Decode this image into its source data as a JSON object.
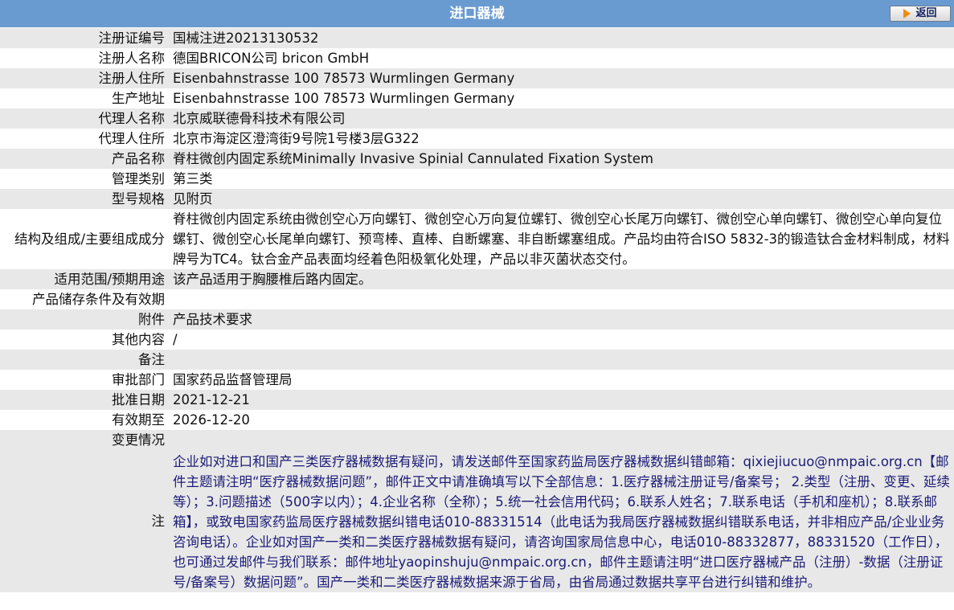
{
  "header": {
    "title": "进口器械",
    "back_label": "返回"
  },
  "rows": [
    {
      "label": "注册证编号",
      "value": "国械注进20213130532"
    },
    {
      "label": "注册人名称",
      "value": "德国BRICON公司 bricon GmbH"
    },
    {
      "label": "注册人住所",
      "value": "Eisenbahnstrasse 100 78573 Wurmlingen Germany"
    },
    {
      "label": "生产地址",
      "value": "Eisenbahnstrasse 100 78573 Wurmlingen Germany"
    },
    {
      "label": "代理人名称",
      "value": "北京威联德骨科技术有限公司"
    },
    {
      "label": "代理人住所",
      "value": "北京市海淀区澄湾街9号院1号楼3层G322"
    },
    {
      "label": "产品名称",
      "value": "脊柱微创内固定系统Minimally Invasive Spinial Cannulated Fixation System"
    },
    {
      "label": "管理类别",
      "value": "第三类"
    },
    {
      "label": "型号规格",
      "value": "见附页"
    },
    {
      "label": "结构及组成/主要组成成分",
      "value": "脊柱微创内固定系统由微创空心万向螺钉、微创空心万向复位螺钉、微创空心长尾万向螺钉、微创空心单向螺钉、微创空心单向复位螺钉、微创空心长尾单向螺钉、预弯棒、直棒、自断螺塞、非自断螺塞组成。产品均由符合ISO 5832-3的锻造钛合金材料制成，材料牌号为TC4。钛合金产品表面均经着色阳极氧化处理，产品以非灭菌状态交付。"
    },
    {
      "label": "适用范围/预期用途",
      "value": "该产品适用于胸腰椎后路内固定。"
    },
    {
      "label": "产品储存条件及有效期",
      "value": ""
    },
    {
      "label": "附件",
      "value": "产品技术要求"
    },
    {
      "label": "其他内容",
      "value": "/"
    },
    {
      "label": "备注",
      "value": ""
    },
    {
      "label": "审批部门",
      "value": "国家药品监督管理局"
    },
    {
      "label": "批准日期",
      "value": "2021-12-21"
    },
    {
      "label": "有效期至",
      "value": "2026-12-20"
    },
    {
      "label": "变更情况",
      "value": ""
    }
  ],
  "note": {
    "label": "注",
    "text": "企业如对进口和国产三类医疗器械数据有疑问，请发送邮件至国家药监局医疗器械数据纠错邮箱：qixiejiucuo@nmpaic.org.cn【邮件主题请注明“医疗器械数据问题”，邮件正文中请准确填写以下全部信息：1.医疗器械注册证号/备案号； 2.类型（注册、变更、延续等）；3.问题描述（500字以内）；4.企业名称（全称）；5.统一社会信用代码；6.联系人姓名；7.联系电话（手机和座机）；8.联系邮箱】，或致电国家药监局医疗器械数据纠错电话010-88331514（此电话为我局医疗器械数据纠错联系电话，并非相应产品/企业业务咨询电话）。企业如对国产一类和二类医疗器械数据有疑问，请咨询国家局信息中心，电话010-88332877，88331520（工作日），也可通过发邮件与我们联系：邮件地址yaopinshuju@nmpaic.org.cn，邮件主题请注明“进口医疗器械产品（注册）-数据（注册证号/备案号）数据问题”。国产一类和二类医疗器械数据来源于省局，由省局通过数据共享平台进行纠错和维护。"
  }
}
